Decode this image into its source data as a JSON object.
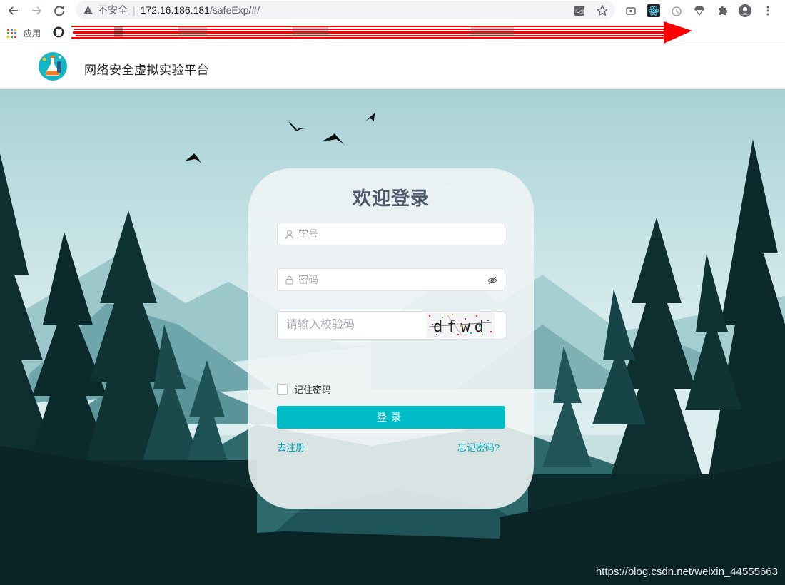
{
  "browser": {
    "security_label": "不安全",
    "url_host": "172.16.186.181",
    "url_path": "/safeExp/#/",
    "bookmarks": {
      "apps_label": "应用"
    }
  },
  "site": {
    "title": "网络安全虚拟实验平台"
  },
  "login": {
    "heading": "欢迎登录",
    "username_placeholder": "学号",
    "password_placeholder": "密码",
    "captcha_placeholder": "请输入校验码",
    "captcha_text": "dfwd",
    "remember_label": "记住密码",
    "submit_label": "登录",
    "register_link": "去注册",
    "forgot_link": "忘记密码?"
  },
  "watermark": "https://blog.csdn.net/weixin_44555663",
  "colors": {
    "accent": "#00bcc7",
    "link": "#00a7b5",
    "forest_dark": "#0c2a2b",
    "sky": "#cfe6e8"
  }
}
